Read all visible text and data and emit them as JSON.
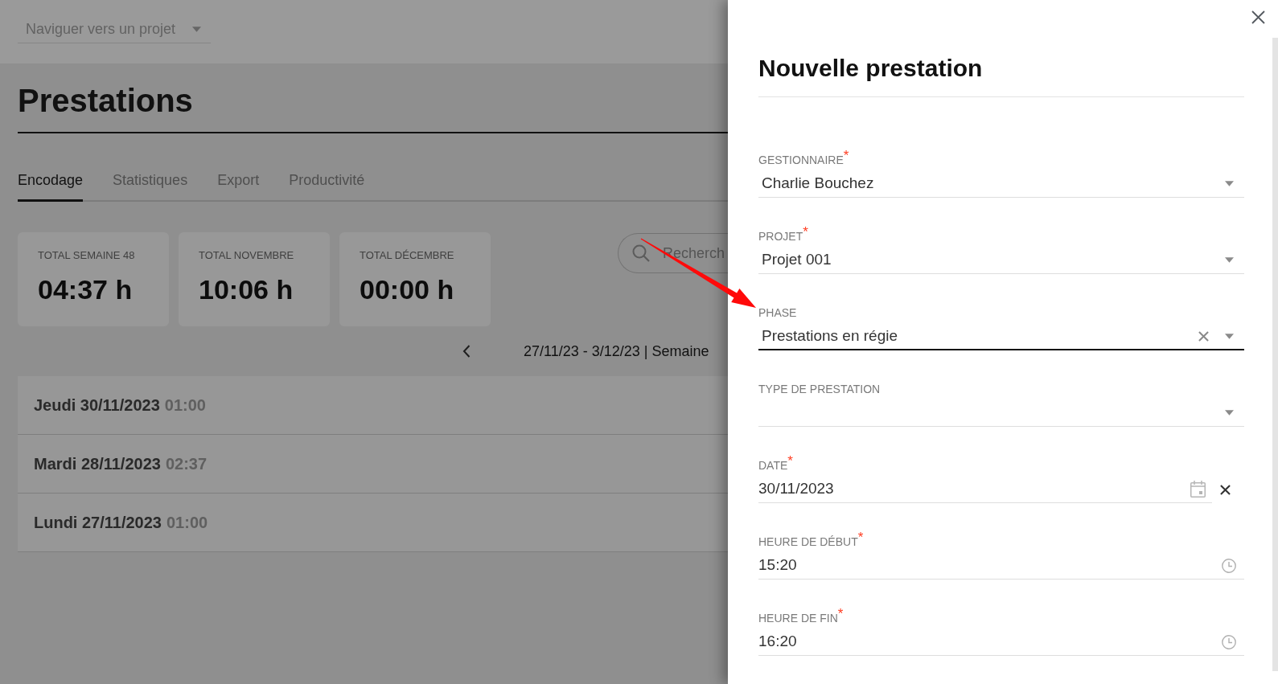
{
  "top_bar": {
    "project_select": {
      "placeholder": "Naviguer vers un projet"
    }
  },
  "page_title": "Prestations",
  "tabs": [
    {
      "label": "Encodage",
      "selected": true
    },
    {
      "label": "Statistiques",
      "selected": false
    },
    {
      "label": "Export",
      "selected": false
    },
    {
      "label": "Productivité",
      "selected": false
    }
  ],
  "totals": [
    {
      "label": "TOTAL SEMAINE 48",
      "value": "04:37 h"
    },
    {
      "label": "TOTAL NOVEMBRE",
      "value": "10:06 h"
    },
    {
      "label": "TOTAL DÉCEMBRE",
      "value": "00:00 h"
    }
  ],
  "search": {
    "placeholder": "Recherch"
  },
  "week_nav": {
    "range": "27/11/23 - 3/12/23 | Semaine"
  },
  "days": [
    {
      "date": "Jeudi 30/11/2023",
      "duration": "01:00"
    },
    {
      "date": "Mardi 28/11/2023",
      "duration": "02:37"
    },
    {
      "date": "Lundi 27/11/2023",
      "duration": "01:00"
    }
  ],
  "panel": {
    "title": "Nouvelle prestation",
    "fields": [
      {
        "kind": "select",
        "label": "GESTIONNAIRE$^{*}$",
        "value": "Charlie Bouchez",
        "focused": false,
        "clearable": false
      },
      {
        "kind": "select",
        "label": "PROJET$^{*}$",
        "value": "Projet 001",
        "focused": false,
        "clearable": false
      },
      {
        "kind": "select",
        "label": "PHASE",
        "value": "Prestations en régie",
        "focused": true,
        "clearable": true
      },
      {
        "kind": "select",
        "label": "TYPE DE PRESTATION",
        "focused": false,
        "clearable": false
      },
      {
        "kind": "date",
        "label": "DATE$^{*}$",
        "value": "30/11/2023",
        "focused": false,
        "clearable": true
      },
      {
        "kind": "time",
        "label": "HEURE DE DÉBUT$^{*}$",
        "value": "15:20",
        "focused": false,
        "clearable": false
      },
      {
        "kind": "time",
        "label": "HEURE DE FIN$^{*}$",
        "value": "16:20",
        "focused": false,
        "clearable": false
      }
    ]
  }
}
